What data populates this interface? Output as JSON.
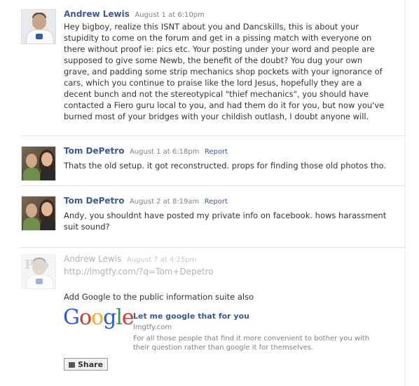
{
  "comments": [
    {
      "author": "Andrew Lewis",
      "timestamp": "August 1 at 6:10pm",
      "text": "Hey bigboy, realize this ISNT about you and Dancskills, this is about your stupidity to come on the forum and get in a pissing match with everyone on there without proof ie: pics etc. Your posting under your word and people are supposed to give some Newb, the benefit of the doubt? You dug your own grave, and padding some strip mechanics shop pockets with your ignorance of cars, which you continue to praise like the lord Jesus, hopefully they are a decent bunch and not the stereotypical \"thief mechanics\", you should have contacted a Fiero guru local to you, and had them do it for you, but now you've burned most of your bridges with your childish outlash, I doubt anyone will."
    },
    {
      "author": "Tom DePetro",
      "timestamp": "August 1 at 6:18pm",
      "report": "Report",
      "text": "Thats the old setup. it got reconstructed. props for finding those old photos tho."
    },
    {
      "author": "Tom DePetro",
      "timestamp": "August 2 at 8:19am",
      "report": "Report",
      "text": "Andy, you shouldnt have posted my private info on facebook. hows harassment suit sound?"
    },
    {
      "author": "Andrew Lewis",
      "timestamp": "August 7 at 4:25pm",
      "link": "http://lmgtfy.com/?q=Tom+Depetro",
      "text": "Add Google to the public information suite also",
      "preview": {
        "logo": [
          "G",
          "o",
          "o",
          "g",
          "l",
          "e"
        ],
        "title": "Let me google that for you",
        "domain": "lmgtfy.com",
        "description": "For all those people that find it more convenient to bother you with their question rather than google it for themselves."
      },
      "share_label": "Share"
    }
  ],
  "colors": {
    "link": "#3b5998",
    "meta": "#808080"
  }
}
